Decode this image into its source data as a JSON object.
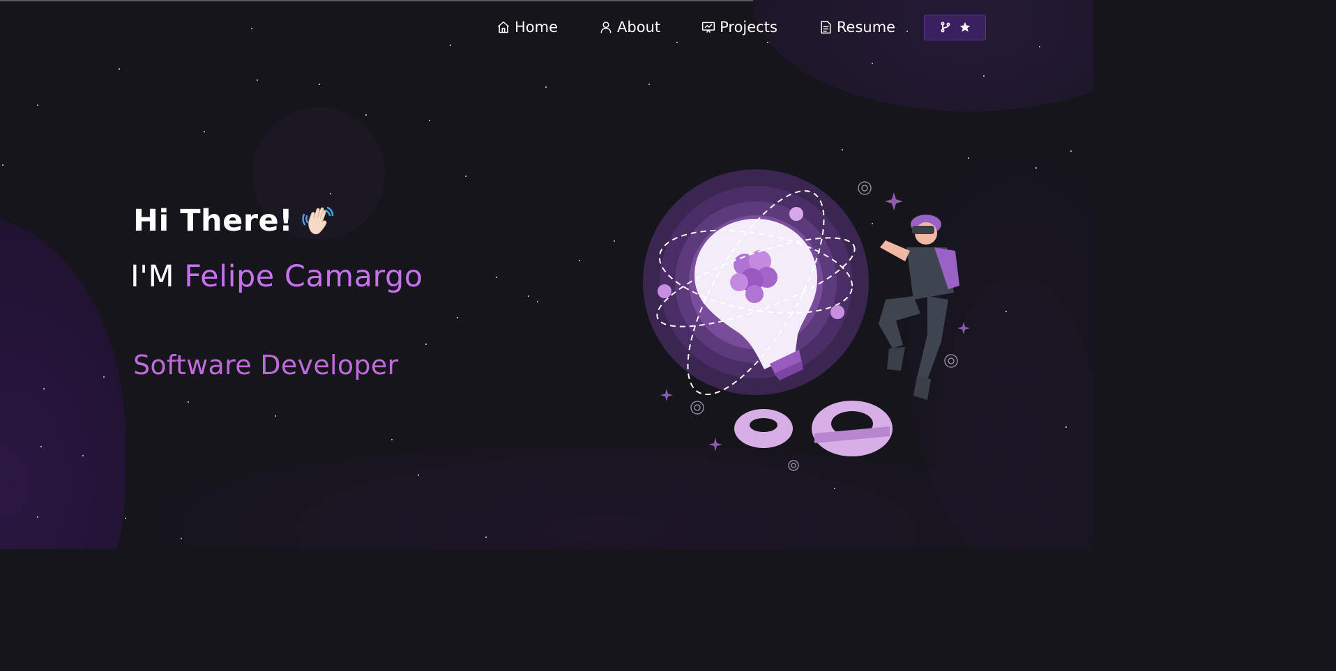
{
  "nav": {
    "items": [
      {
        "label": "Home",
        "icon": "home-icon"
      },
      {
        "label": "About",
        "icon": "user-icon"
      },
      {
        "label": "Projects",
        "icon": "projects-icon"
      },
      {
        "label": "Resume",
        "icon": "document-icon"
      }
    ],
    "github_button": {
      "icons": [
        "fork-icon",
        "star-icon"
      ]
    }
  },
  "hero": {
    "greeting": "Hi There!",
    "greeting_emoji": "waving-hand-icon",
    "intro_prefix": "I'M",
    "name": "Felipe Camargo",
    "role": "Software Developer"
  },
  "colors": {
    "accent": "#c770f0",
    "role": "#be6ad9",
    "background": "#15151b",
    "button_bg": "#3a2060"
  }
}
